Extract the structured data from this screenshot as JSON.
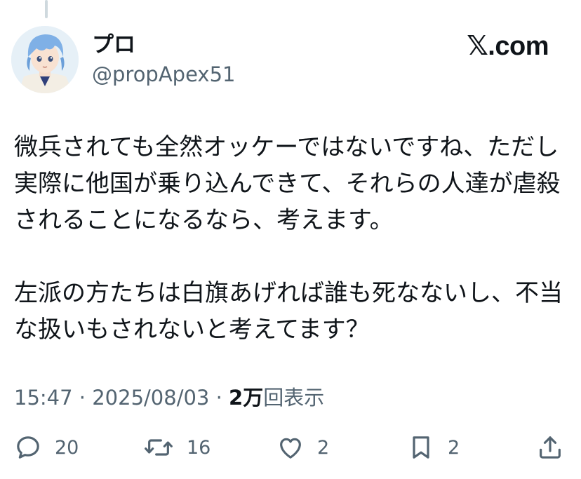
{
  "post": {
    "author": {
      "display_name": "プロ",
      "handle": "@propApex51",
      "avatar_icon": "anime-avatar"
    },
    "brand": "𝕏.com",
    "text": {
      "paragraphs": [
        [
          "微兵されても全然オッケーではないですね、ただし",
          "実際に他国が乗り込んできて、それらの人達が虐殺",
          "されることになるなら、考えます。"
        ],
        [
          "左派の方たちは白旗あげれば誰も死なないし、不当",
          "な扱いもされないと考えてます？"
        ]
      ]
    },
    "meta": {
      "time": "15:47",
      "date": "2025/08/03",
      "separator": "·",
      "views_count": "2万",
      "views_label": "回表示"
    },
    "actions": {
      "replies": "20",
      "reposts": "16",
      "likes": "2",
      "bookmarks": "2"
    }
  },
  "colors": {
    "text_primary": "#0f1419",
    "text_secondary": "#536471",
    "thread_line": "#cfd9de"
  }
}
